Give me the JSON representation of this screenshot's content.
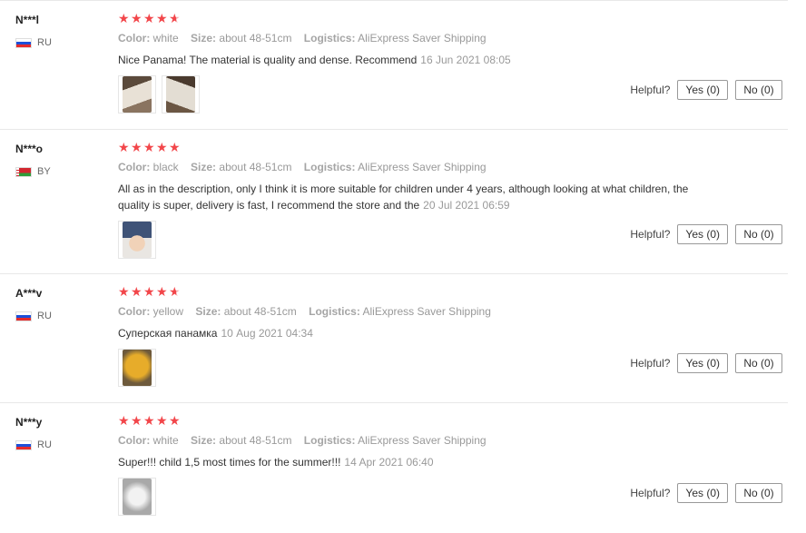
{
  "reviews": [
    {
      "user": "N***l",
      "country": "RU",
      "flag": "ru",
      "stars": 4.5,
      "color_label": "Color:",
      "color": "white",
      "size_label": "Size:",
      "size": "about 48-51cm",
      "logistics_label": "Logistics:",
      "logistics": "AliExpress Saver Shipping",
      "text": "Nice Panama! The material is quality and dense. Recommend",
      "date": "16 Jun 2021 08:05",
      "photos": [
        "#c8b9a6",
        "#a89583"
      ],
      "helpful": "Helpful?",
      "yes": "Yes (0)",
      "no": "No (0)"
    },
    {
      "user": "N***o",
      "country": "BY",
      "flag": "by",
      "stars": 5,
      "color_label": "Color:",
      "color": "black",
      "size_label": "Size:",
      "size": "about 48-51cm",
      "logistics_label": "Logistics:",
      "logistics": "AliExpress Saver Shipping",
      "text": "All as in the description, only I think it is more suitable for children under 4 years, although looking at what children, the quality is super, delivery is fast, I recommend the store and the",
      "date": "20 Jul 2021 06:59",
      "photos": [
        "#4a5f80"
      ],
      "helpful": "Helpful?",
      "yes": "Yes (0)",
      "no": "No (0)"
    },
    {
      "user": "A***v",
      "country": "RU",
      "flag": "ru",
      "stars": 4.5,
      "color_label": "Color:",
      "color": "yellow",
      "size_label": "Size:",
      "size": "about 48-51cm",
      "logistics_label": "Logistics:",
      "logistics": "AliExpress Saver Shipping",
      "text": "Суперская панамка",
      "date": "10 Aug 2021 04:34",
      "photos": [
        "#d49a1c"
      ],
      "helpful": "Helpful?",
      "yes": "Yes (0)",
      "no": "No (0)"
    },
    {
      "user": "N***y",
      "country": "RU",
      "flag": "ru",
      "stars": 5,
      "color_label": "Color:",
      "color": "white",
      "size_label": "Size:",
      "size": "about 48-51cm",
      "logistics_label": "Logistics:",
      "logistics": "AliExpress Saver Shipping",
      "text": "Super!!! child 1,5 most times for the summer!!!",
      "date": "14 Apr 2021 06:40",
      "photos": [
        "#bdbdbd"
      ],
      "helpful": "Helpful?",
      "yes": "Yes (0)",
      "no": "No (0)"
    }
  ]
}
